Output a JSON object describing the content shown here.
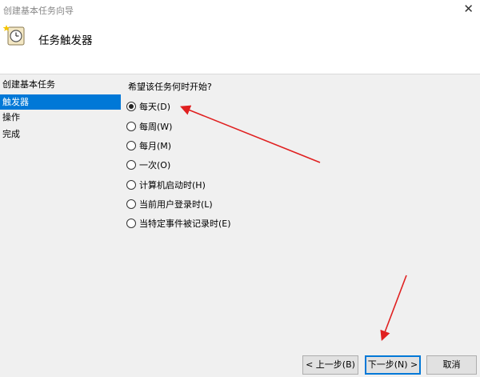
{
  "window": {
    "title": "创建基本任务向导",
    "close_glyph": "✕"
  },
  "header": {
    "title": "任务触发器",
    "icon": "clock-task-icon"
  },
  "sidebar": {
    "items": [
      {
        "label": "创建基本任务",
        "active": false
      },
      {
        "label": "触发器",
        "active": true
      },
      {
        "label": "操作",
        "active": false
      },
      {
        "label": "完成",
        "active": false
      }
    ]
  },
  "main": {
    "question": "希望该任务何时开始?",
    "options": [
      {
        "label": "每天(D)",
        "checked": true
      },
      {
        "label": "每周(W)",
        "checked": false
      },
      {
        "label": "每月(M)",
        "checked": false
      },
      {
        "label": "一次(O)",
        "checked": false
      },
      {
        "label": "计算机启动时(H)",
        "checked": false
      },
      {
        "label": "当前用户登录时(L)",
        "checked": false
      },
      {
        "label": "当特定事件被记录时(E)",
        "checked": false
      }
    ]
  },
  "buttons": {
    "back": "< 上一步(B)",
    "next": "下一步(N) >",
    "cancel": "取消"
  },
  "colors": {
    "selection": "#0078d7",
    "annotation_arrow": "#e02020"
  }
}
